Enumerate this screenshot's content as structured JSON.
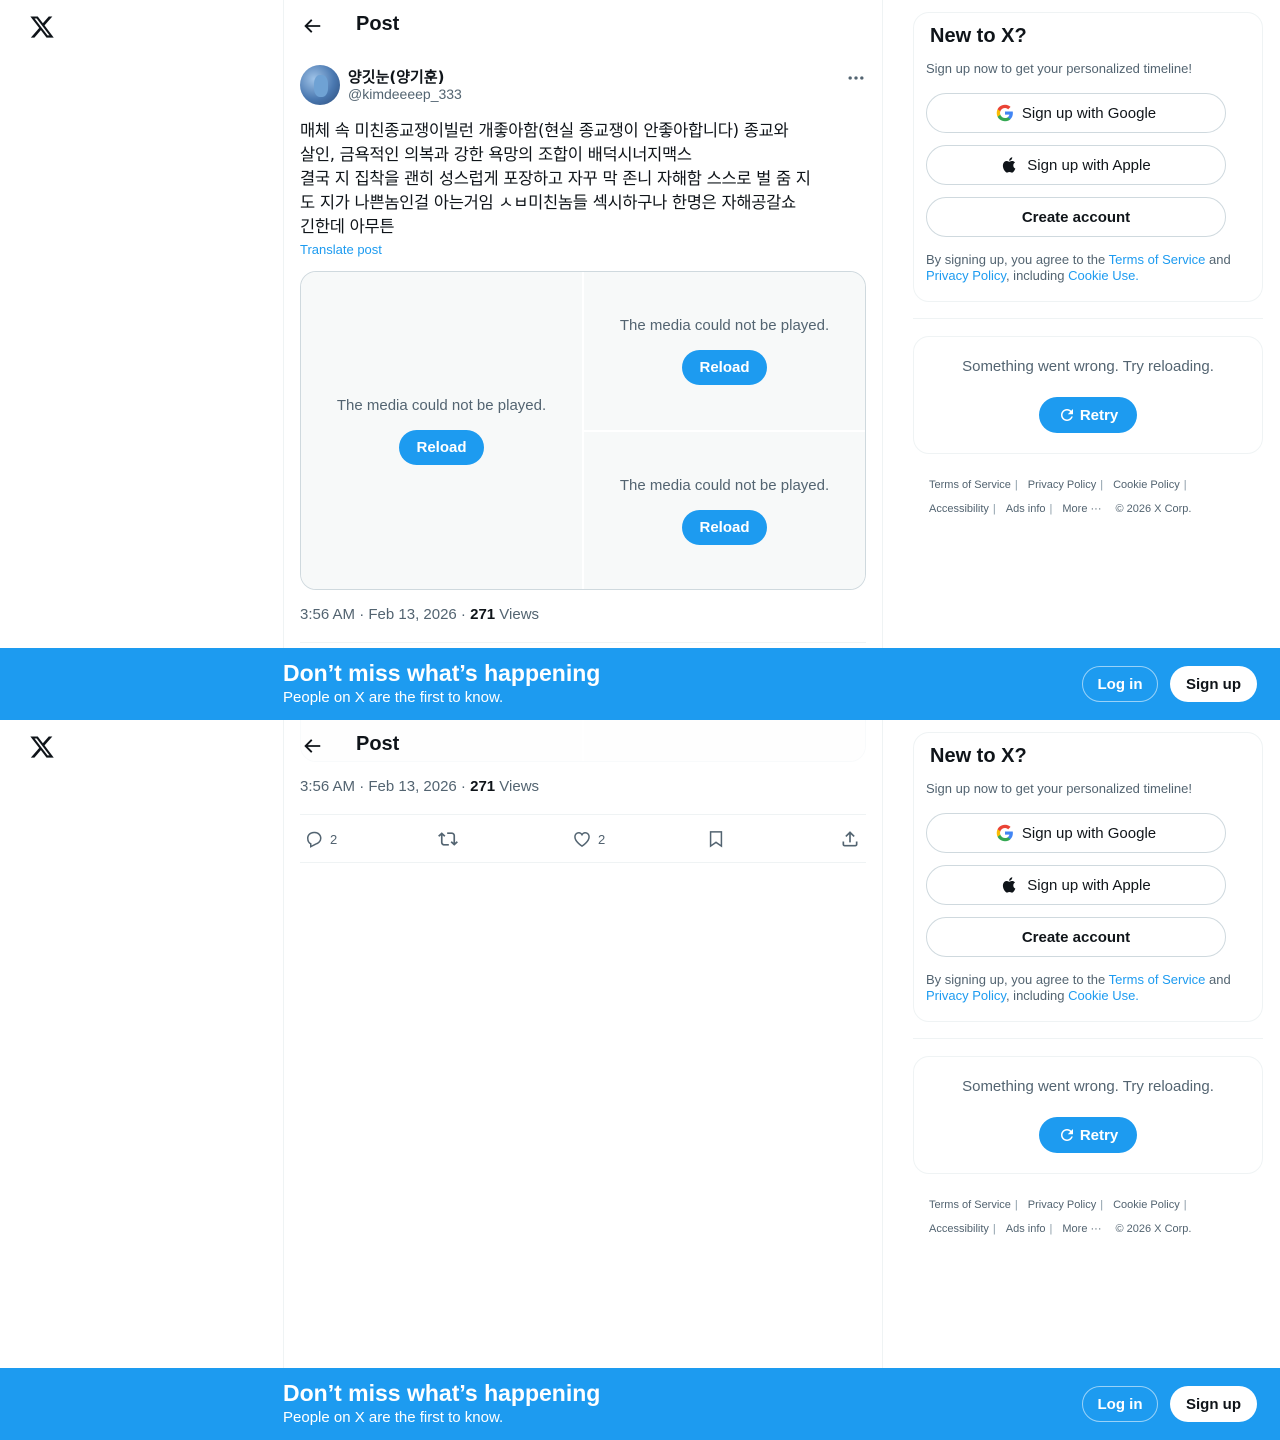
{
  "header": {
    "title": "Post"
  },
  "post": {
    "display_name": "양깃눈(양기훈)",
    "handle": "@kimdeeeep_333",
    "text": "매체 속 미친종교쟁이빌런 개좋아함(현실 종교쟁이 안좋아합니다) 종교와\n살인, 금욕적인 의복과 강한 욕망의 조합이 배덕시너지맥스\n결국 지 집착을 괜히 성스럽게 포장하고 자꾸 막 존니 자해함 스스로 벌 줌 지\n도 지가 나쁜놈인걸 아는거임 ㅅㅂ미친놈들 섹시하구나 한명은 자해공갈쇼\n긴한데 아무튼",
    "translate_label": "Translate post",
    "media": [
      {
        "message": "The media could not be played.",
        "button": "Reload"
      },
      {
        "message": "The media could not be played.",
        "button": "Reload"
      },
      {
        "message": "The media could not be played.",
        "button": "Reload"
      }
    ],
    "timestamp": "3:56 AM · Feb 13, 2026 · ",
    "views_count": "271",
    "views_label": " Views",
    "reply_count": "2",
    "like_count": "2"
  },
  "sidebar": {
    "signup": {
      "title": "New to X?",
      "subtitle": "Sign up now to get your personalized timeline!",
      "google_label": "Sign up with Google",
      "apple_label": "Sign up with Apple",
      "create_label": "Create account",
      "terms_prefix": "By signing up, you agree to the ",
      "terms_link": "Terms of Service",
      "terms_and": " and ",
      "privacy_link": "Privacy Policy",
      "terms_including": ", including ",
      "cookie_link": "Cookie Use."
    },
    "error": {
      "message": "Something went wrong. Try reloading.",
      "retry_label": "Retry"
    },
    "footer": {
      "terms": "Terms of Service",
      "privacy": "Privacy Policy",
      "cookie": "Cookie Policy",
      "accessibility": "Accessibility",
      "ads": "Ads info",
      "more": "More ···",
      "copyright": "© 2026 X Corp."
    }
  },
  "banner": {
    "title": "Don’t miss what’s happening",
    "subtitle": "People on X are the first to know.",
    "login_label": "Log in",
    "signup_label": "Sign up"
  },
  "colors": {
    "accent": "#1d9bf0",
    "text": "#0f1419",
    "muted": "#536471",
    "border": "#eff3f4"
  },
  "icons": [
    "x-logo-icon",
    "back-arrow-icon",
    "more-icon",
    "reply-icon",
    "repost-icon",
    "like-icon",
    "bookmark-icon",
    "share-icon",
    "google-icon",
    "apple-icon",
    "retry-icon"
  ]
}
